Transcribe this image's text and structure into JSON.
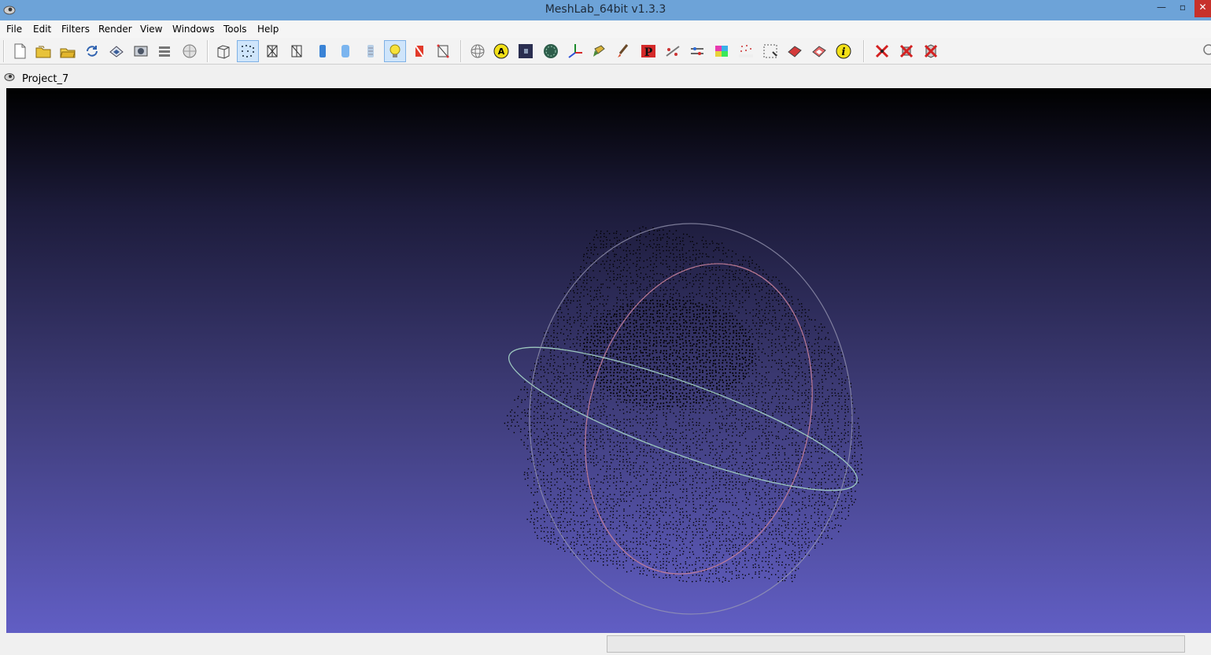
{
  "window": {
    "title": "MeshLab_64bit v1.3.3",
    "minimize_glyph": "—",
    "maximize_glyph": "▫",
    "close_glyph": "✕"
  },
  "menubar": {
    "items": [
      "File",
      "Edit",
      "Filters",
      "Render",
      "View",
      "Windows",
      "Tools",
      "Help"
    ]
  },
  "toolbar": {
    "groups": [
      [
        "new-document-icon",
        "open-folder-icon",
        "open-project-icon",
        "reload-icon",
        "save-icon",
        "snapshot-icon",
        "layers-icon",
        "globe-icon"
      ],
      [
        "bounding-box-icon",
        "points-render-icon",
        "wireframe-icon",
        "hidden-lines-icon",
        "flat-shading-icon",
        "smooth-shading-icon",
        "texture-icon",
        "light-bulb-icon",
        "two-sided-lighting-icon",
        "draw-mode-icon"
      ],
      [
        "sphere-trackball-icon",
        "annotate-icon",
        "dark-square-icon",
        "texture-sphere-icon",
        "axes-icon",
        "select-paint-icon",
        "paint-brush-icon",
        "pick-points-icon",
        "measure-icon",
        "align-icon",
        "color-icon",
        "reference-icon",
        "select-faces-icon",
        "select-vertices-icon",
        "select-connected-icon",
        "info-icon"
      ],
      [
        "delete-vertices-icon",
        "delete-faces-icon",
        "delete-all-icon"
      ]
    ],
    "active": [
      "points-render-icon",
      "light-bulb-icon"
    ]
  },
  "subwindow": {
    "title": "Project_7"
  },
  "viewport": {
    "background_top": "#000000",
    "background_bottom": "#615ec4",
    "trackball_colors": [
      "#c47f9a",
      "#a7d7c8",
      "#9a9ab4"
    ],
    "point_color": "#000000"
  },
  "statusbar": {
    "progress_value": 0
  }
}
